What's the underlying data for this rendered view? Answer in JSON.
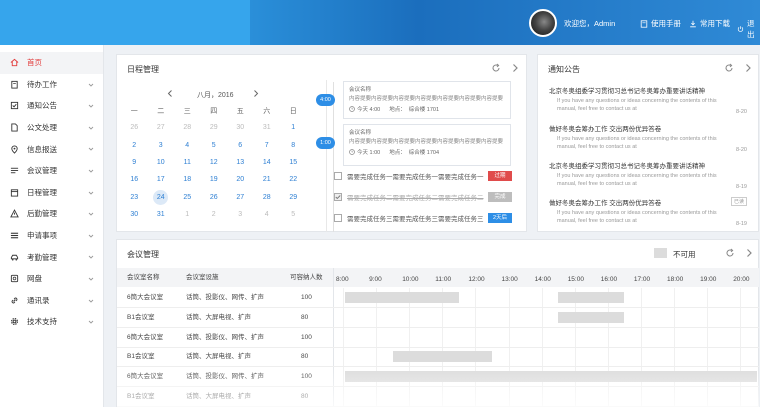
{
  "header": {
    "welcome": "欢迎您，Admin",
    "manual": "使用手册",
    "downloads": "常用下载",
    "logout": "退出"
  },
  "sidebar": {
    "items": [
      {
        "label": "首页",
        "icon": "home-icon",
        "active": true
      },
      {
        "label": "待办工作",
        "icon": "clipboard-icon"
      },
      {
        "label": "通知公告",
        "icon": "check-square-icon"
      },
      {
        "label": "公文处理",
        "icon": "document-icon"
      },
      {
        "label": "信息报送",
        "icon": "location-pin-icon"
      },
      {
        "label": "会议管理",
        "icon": "meeting-icon"
      },
      {
        "label": "日程管理",
        "icon": "calendar-icon"
      },
      {
        "label": "后勤管理",
        "icon": "warning-icon"
      },
      {
        "label": "申请事项",
        "icon": "list-icon"
      },
      {
        "label": "考勤管理",
        "icon": "car-icon"
      },
      {
        "label": "网盘",
        "icon": "disk-icon"
      },
      {
        "label": "通讯录",
        "icon": "link-icon"
      },
      {
        "label": "技术支持",
        "icon": "gear-icon"
      }
    ]
  },
  "schedule": {
    "title": "日程管理",
    "month_label": "八月，2016",
    "weekdays": [
      "一",
      "二",
      "三",
      "四",
      "五",
      "六",
      "日"
    ],
    "weeks": [
      [
        "26",
        "27",
        "28",
        "29",
        "30",
        "31",
        "1"
      ],
      [
        "2",
        "3",
        "4",
        "5",
        "6",
        "7",
        "8"
      ],
      [
        "9",
        "10",
        "11",
        "12",
        "13",
        "14",
        "15"
      ],
      [
        "16",
        "17",
        "18",
        "19",
        "20",
        "21",
        "22"
      ],
      [
        "23",
        "24",
        "25",
        "26",
        "27",
        "28",
        "29"
      ],
      [
        "30",
        "31",
        "1",
        "2",
        "3",
        "4",
        "5"
      ]
    ],
    "events": [
      {
        "time": "4:00",
        "title": "会议名称",
        "desc": "内容提要内容提要内容提要内容提要内容提要内容提要内容提要",
        "when": "今天 4:00",
        "place_label": "地点：",
        "place": "综合楼 1701"
      },
      {
        "time": "1:00",
        "title": "会议名称",
        "desc": "内容提要内容提要内容提要内容提要内容提要内容提要内容提要",
        "when": "今天 1:00",
        "place_label": "地点：",
        "place": "综合楼 1704"
      }
    ],
    "tasks": [
      {
        "text": "需要完成任务一需要完成任务一需要完成任务一",
        "tag": "过期",
        "tag_color": "#e04b4b",
        "done": false
      },
      {
        "text": "需要完成任务二需要完成任务二需要完成任务二",
        "tag": "完成",
        "tag_color": "#bdbdbd",
        "done": true
      },
      {
        "text": "需要完成任务三需要完成任务三需要完成任务三",
        "tag": "2天后",
        "tag_color": "#2d8ee6",
        "done": false
      }
    ]
  },
  "notices": {
    "title": "通知公告",
    "items": [
      {
        "title": "北京冬奥组委学习贯彻习总书记冬奥筹办重要讲话精神",
        "desc": "If you have any questions or ideas concerning the contents of this manual, feel free to contact us at",
        "date": "8-20",
        "unread": true
      },
      {
        "title": "做好冬奥会筹办工作 交出两份优异答卷",
        "desc": "If you have any questions or ideas concerning the contents of this manual, feel free to contact us at",
        "date": "8-20"
      },
      {
        "title": "北京冬奥组委学习贯彻习总书记冬奥筹办重要讲话精神",
        "desc": "If you have any questions or ideas concerning the contents of this manual, feel free to contact us at",
        "date": "8-19"
      },
      {
        "title": "做好冬奥会筹办工作 交出两份优异答卷",
        "desc": "If you have any questions or ideas concerning the contents of this manual, feel free to contact us at",
        "date": "8-19",
        "tag": "已读"
      }
    ]
  },
  "meetings": {
    "title": "会议管理",
    "legend": "不可用",
    "columns": [
      "会议室名称",
      "会议室设施",
      "可容纳人数"
    ],
    "hours": [
      "8:00",
      "9:00",
      "10:00",
      "11:00",
      "12:00",
      "13:00",
      "14:00",
      "15:00",
      "16:00",
      "17:00",
      "18:00",
      "19:00",
      "20:00"
    ],
    "rooms": [
      {
        "name": "6筒大会议室",
        "facilities": "话筒、投影仪、网传、扩声",
        "capacity": "100",
        "busy": [
          [
            8.0,
            11.5
          ],
          [
            14.5,
            16.5
          ]
        ]
      },
      {
        "name": "B1会议室",
        "facilities": "话筒、大屏电视、扩声",
        "capacity": "80",
        "busy": [
          [
            14.5,
            16.5
          ]
        ]
      },
      {
        "name": "6筒大会议室",
        "facilities": "话筒、投影仪、网传、扩声",
        "capacity": "100",
        "busy": []
      },
      {
        "name": "B1会议室",
        "facilities": "话筒、大屏电视、扩声",
        "capacity": "80",
        "busy": [
          [
            9.5,
            12.5
          ]
        ]
      },
      {
        "name": "6筒大会议室",
        "facilities": "话筒、投影仪、网传、扩声",
        "capacity": "100",
        "busy": [
          [
            8.0,
            20.5
          ]
        ]
      },
      {
        "name": "B1会议室",
        "facilities": "话筒、大屏电视、扩声",
        "capacity": "80",
        "busy": []
      }
    ]
  }
}
